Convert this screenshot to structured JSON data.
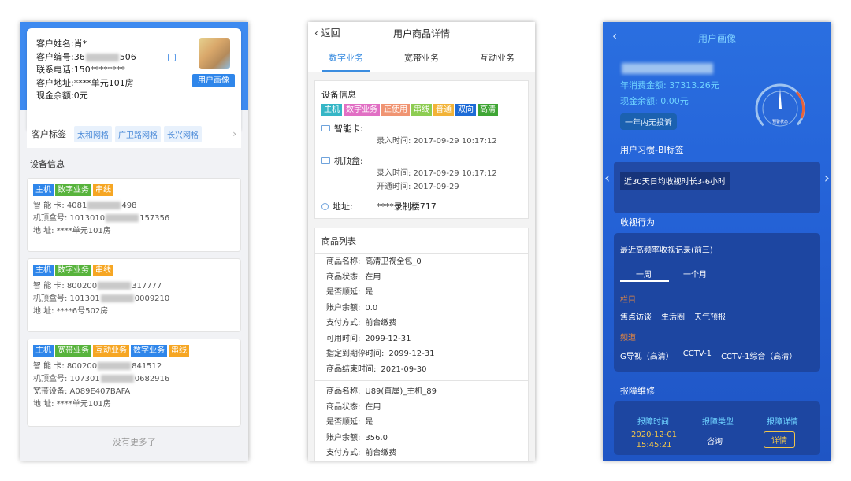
{
  "panel1": {
    "customer": {
      "name_label": "客户姓名:",
      "name": "肖*",
      "id_label": "客户编号:",
      "id_prefix": "36",
      "id_suffix": "506",
      "phone_label": "联系电话:",
      "phone": "150********",
      "address_label": "客户地址:",
      "address": "****单元101房",
      "cash_label": "现金余额:",
      "cash": "0元"
    },
    "portrait_button": "用户画像",
    "tags_label": "客户标签",
    "tags": [
      "太和网格",
      "广卫路网格",
      "长兴网格"
    ],
    "device_section": "设备信息",
    "devices": [
      {
        "badges": [
          {
            "text": "主机",
            "color": "#2f86ea"
          },
          {
            "text": "数字业务",
            "color": "#57b33c"
          },
          {
            "text": "串线",
            "color": "#f6a623"
          }
        ],
        "lines": [
          {
            "label": "智  能  卡:",
            "pre": "4081",
            "post": "498"
          },
          {
            "label": "机顶盒号:",
            "pre": "1013010",
            "post": "157356"
          },
          {
            "label": "地      址:",
            "pre": "****单元101房",
            "post": ""
          }
        ]
      },
      {
        "badges": [
          {
            "text": "主机",
            "color": "#2f86ea"
          },
          {
            "text": "数字业务",
            "color": "#57b33c"
          },
          {
            "text": "串线",
            "color": "#f6a623"
          }
        ],
        "lines": [
          {
            "label": "智  能  卡:",
            "pre": "800200",
            "post": "317777"
          },
          {
            "label": "机顶盒号:",
            "pre": "101301",
            "post": "0009210"
          },
          {
            "label": "地      址:",
            "pre": "****6号502房",
            "post": ""
          }
        ]
      },
      {
        "badges": [
          {
            "text": "主机",
            "color": "#2f86ea"
          },
          {
            "text": "宽带业务",
            "color": "#57b33c"
          },
          {
            "text": "互动业务",
            "color": "#f6a623"
          },
          {
            "text": "数字业务",
            "color": "#2f86ea"
          },
          {
            "text": "串线",
            "color": "#f6a623"
          }
        ],
        "lines": [
          {
            "label": "智  能  卡:",
            "pre": "800200",
            "post": "841512"
          },
          {
            "label": "机顶盒号:",
            "pre": "107301",
            "post": "0682916"
          },
          {
            "label": "宽带设备:",
            "pre": "A089E407BAFA",
            "post": ""
          },
          {
            "label": "地      址:",
            "pre": "****单元101房",
            "post": ""
          }
        ]
      }
    ],
    "no_more": "没有更多了"
  },
  "panel2": {
    "back": "返回",
    "title": "用户商品详情",
    "tabs": [
      "数字业务",
      "宽带业务",
      "互动业务"
    ],
    "device_info": "设备信息",
    "badges": [
      {
        "text": "主机",
        "color": "#35b6c6"
      },
      {
        "text": "数字业务",
        "color": "#e16fc4"
      },
      {
        "text": "正使用",
        "color": "#f09472"
      },
      {
        "text": "串线",
        "color": "#8dcc52"
      },
      {
        "text": "普通",
        "color": "#f2b337"
      },
      {
        "text": "双向",
        "color": "#1d6bd6"
      },
      {
        "text": "高清",
        "color": "#3ea534"
      }
    ],
    "smartcard_label": "智能卡:",
    "smartcard_entry": "录入时间: 2017-09-29 10:17:12",
    "stb_label": "机顶盒:",
    "stb_entry": "录入时间: 2017-09-29 10:17:12",
    "stb_open": "开通时间: 2017-09-29",
    "address_label": "地址:",
    "address": "****录制楼717",
    "goods_title": "商品列表",
    "goods": [
      [
        [
          "商品名称:",
          "高清卫视全包_0"
        ],
        [
          "商品状态:",
          "在用"
        ],
        [
          "是否顺延:",
          "是"
        ],
        [
          "账户余额:",
          "0.0"
        ],
        [
          "支付方式:",
          "前台缴费"
        ],
        [
          "可用时间:",
          "2099-12-31"
        ],
        [
          "指定到期停时间:",
          "2099-12-31"
        ],
        [
          "商品结束时间:",
          "2021-09-30"
        ]
      ],
      [
        [
          "商品名称:",
          "U89(直属)_主机_89"
        ],
        [
          "商品状态:",
          "在用"
        ],
        [
          "是否顺延:",
          "是"
        ],
        [
          "账户余额:",
          "356.0"
        ],
        [
          "支付方式:",
          "前台缴费"
        ]
      ]
    ]
  },
  "panel3": {
    "title": "用户画像",
    "annual_label": "年消费金额:",
    "annual": "37313.26元",
    "cash_label": "现金余额:",
    "cash": "0.00元",
    "no_complaint": "一年内无投诉",
    "gauge_label": "预警状态",
    "habit_title": "用户习惯-BI标签",
    "habit_tag": "近30天日均收视时长3-6小时",
    "watch_title": "收视行为",
    "watch_box_title": "最近高频率收视记录(前三)",
    "watch_tabs": [
      "一周",
      "一个月"
    ],
    "column_label": "栏目",
    "columns": [
      "焦点访谈",
      "生活圈",
      "天气预报"
    ],
    "channel_label": "频道",
    "channels": [
      "G导视（高清）",
      "CCTV-1",
      "CCTV-1综合（高清）"
    ],
    "repair_title": "报障维修",
    "repair_headers": [
      "报障时间",
      "报障类型",
      "报障详情"
    ],
    "repair_date": "2020-12-01",
    "repair_time": "15:45:21",
    "repair_type": "咨询",
    "repair_btn": "详情"
  }
}
